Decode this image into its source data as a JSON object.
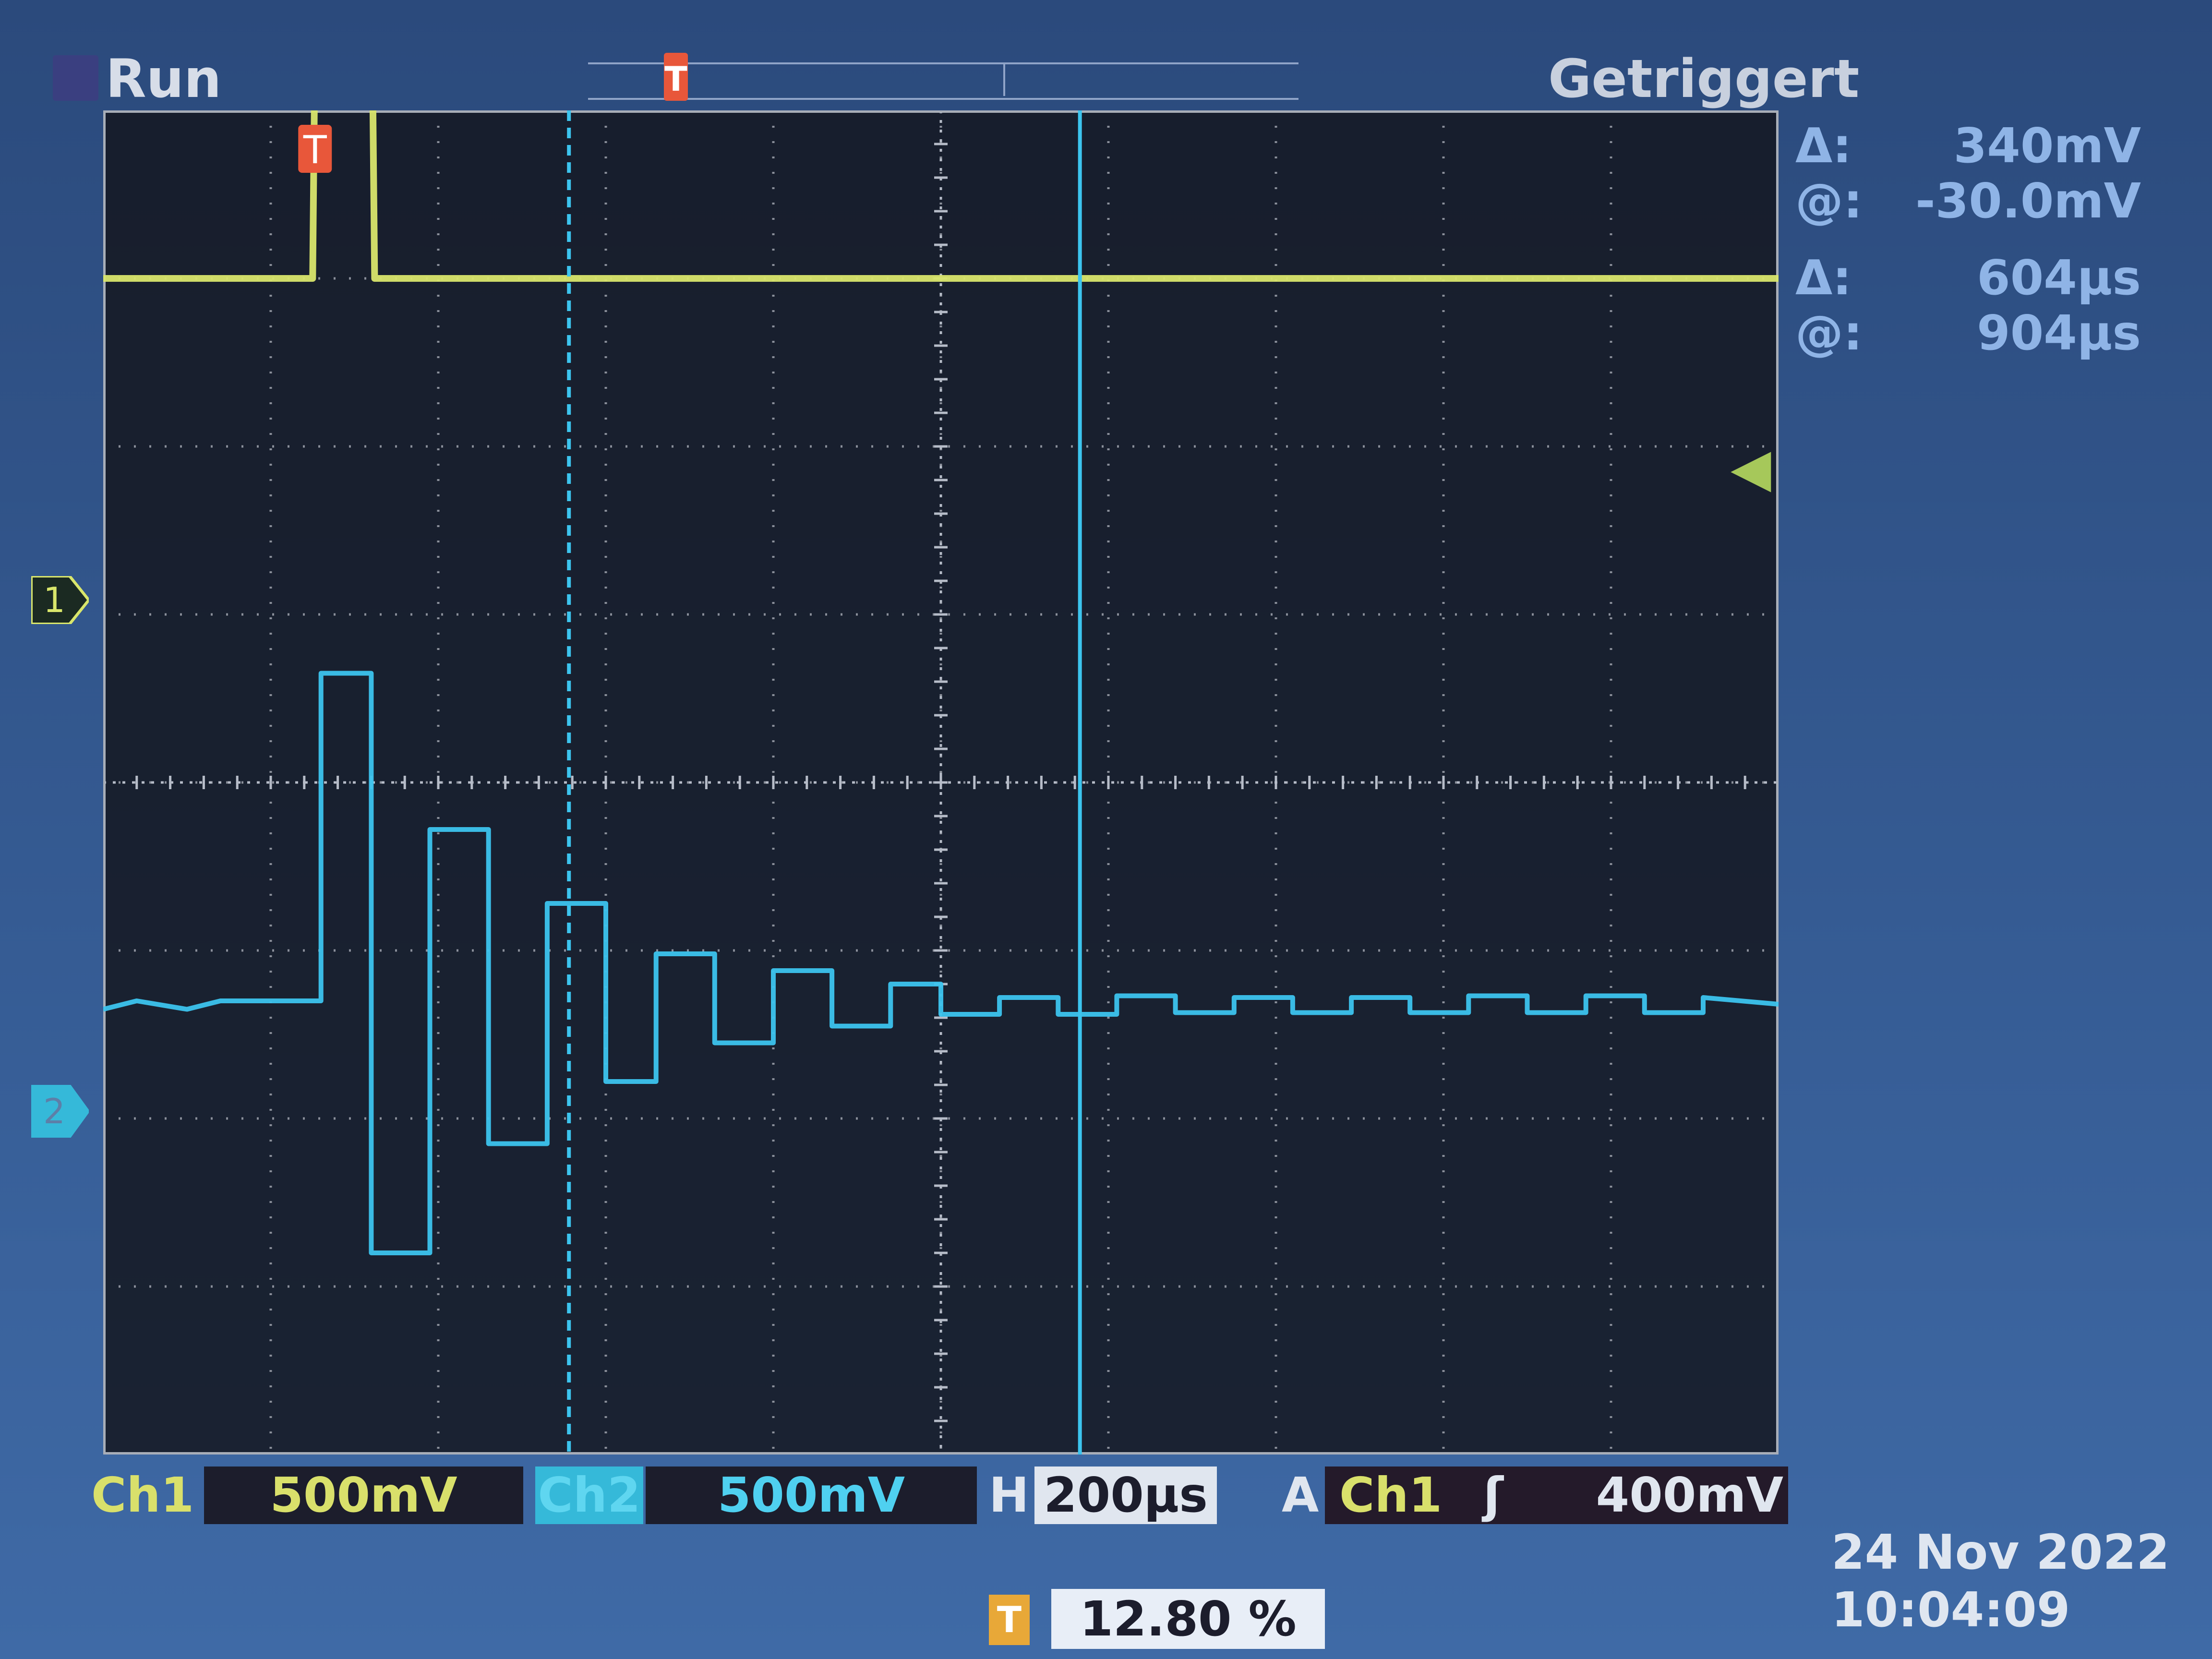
{
  "header": {
    "run_state": "Run",
    "trigger_status": "Getriggert",
    "trigger_marker_label": "T"
  },
  "cursors": {
    "amplitude": {
      "delta_label": "Δ:",
      "delta_value": "340mV",
      "at_label": "@:",
      "at_value": "-30.0mV"
    },
    "time": {
      "delta_label": "Δ:",
      "delta_value": "604µs",
      "at_label": "@:",
      "at_value": "904µs"
    }
  },
  "channels": {
    "ch1": {
      "marker": "1",
      "color": "#d9e66b",
      "name": "Ch1",
      "scale": "500mV"
    },
    "ch2": {
      "marker": "2",
      "color": "#3cc4ee",
      "name": "Ch2",
      "scale": "500mV"
    }
  },
  "horizontal": {
    "label": "H",
    "scale": "200µs"
  },
  "trigger": {
    "mode_label": "A",
    "source": "Ch1",
    "slope_icon": "rising-edge-icon",
    "level": "400mV",
    "position_icon_label": "T",
    "position": "12.80 %"
  },
  "timestamp": {
    "date": "24 Nov 2022",
    "time": "10:04:09"
  },
  "chart_data": {
    "type": "line",
    "x_divisions": 10,
    "y_divisions": 8,
    "series": [
      {
        "name": "Ch1",
        "color": "#d9e66b",
        "x": [
          0.0,
          1.25,
          1.27,
          1.6,
          1.62,
          10.0
        ],
        "y": [
          3.0,
          3.0,
          5.0,
          5.0,
          3.0,
          3.0
        ]
      },
      {
        "name": "Ch2",
        "color": "#3cc4ee",
        "x": [
          0.0,
          0.2,
          0.5,
          0.7,
          1.0,
          1.3,
          1.3,
          1.6,
          1.6,
          1.95,
          1.95,
          2.3,
          2.3,
          2.65,
          2.65,
          3.0,
          3.0,
          3.3,
          3.3,
          3.65,
          3.65,
          4.0,
          4.0,
          4.35,
          4.35,
          4.7,
          4.7,
          5.0,
          5.0,
          5.35,
          5.35,
          5.7,
          5.7,
          6.05,
          6.05,
          6.4,
          6.4,
          6.75,
          6.75,
          7.1,
          7.1,
          7.45,
          7.45,
          7.8,
          7.8,
          8.15,
          8.15,
          8.5,
          8.5,
          8.85,
          8.85,
          9.2,
          9.2,
          9.55,
          9.55,
          10.0
        ],
        "y": [
          0.0,
          0.05,
          0.0,
          0.05,
          0.05,
          0.05,
          2.0,
          2.0,
          -1.45,
          -1.45,
          1.07,
          1.07,
          -0.8,
          -0.8,
          0.63,
          0.63,
          -0.43,
          -0.43,
          0.33,
          0.33,
          -0.2,
          -0.2,
          0.23,
          0.23,
          -0.1,
          -0.1,
          0.15,
          0.15,
          -0.03,
          -0.03,
          0.07,
          0.07,
          -0.03,
          -0.03,
          0.08,
          0.08,
          -0.02,
          -0.02,
          0.07,
          0.07,
          -0.02,
          -0.02,
          0.07,
          0.07,
          -0.02,
          -0.02,
          0.08,
          0.08,
          -0.02,
          -0.02,
          0.08,
          0.08,
          -0.02,
          -0.02,
          0.07,
          0.03
        ]
      }
    ]
  }
}
